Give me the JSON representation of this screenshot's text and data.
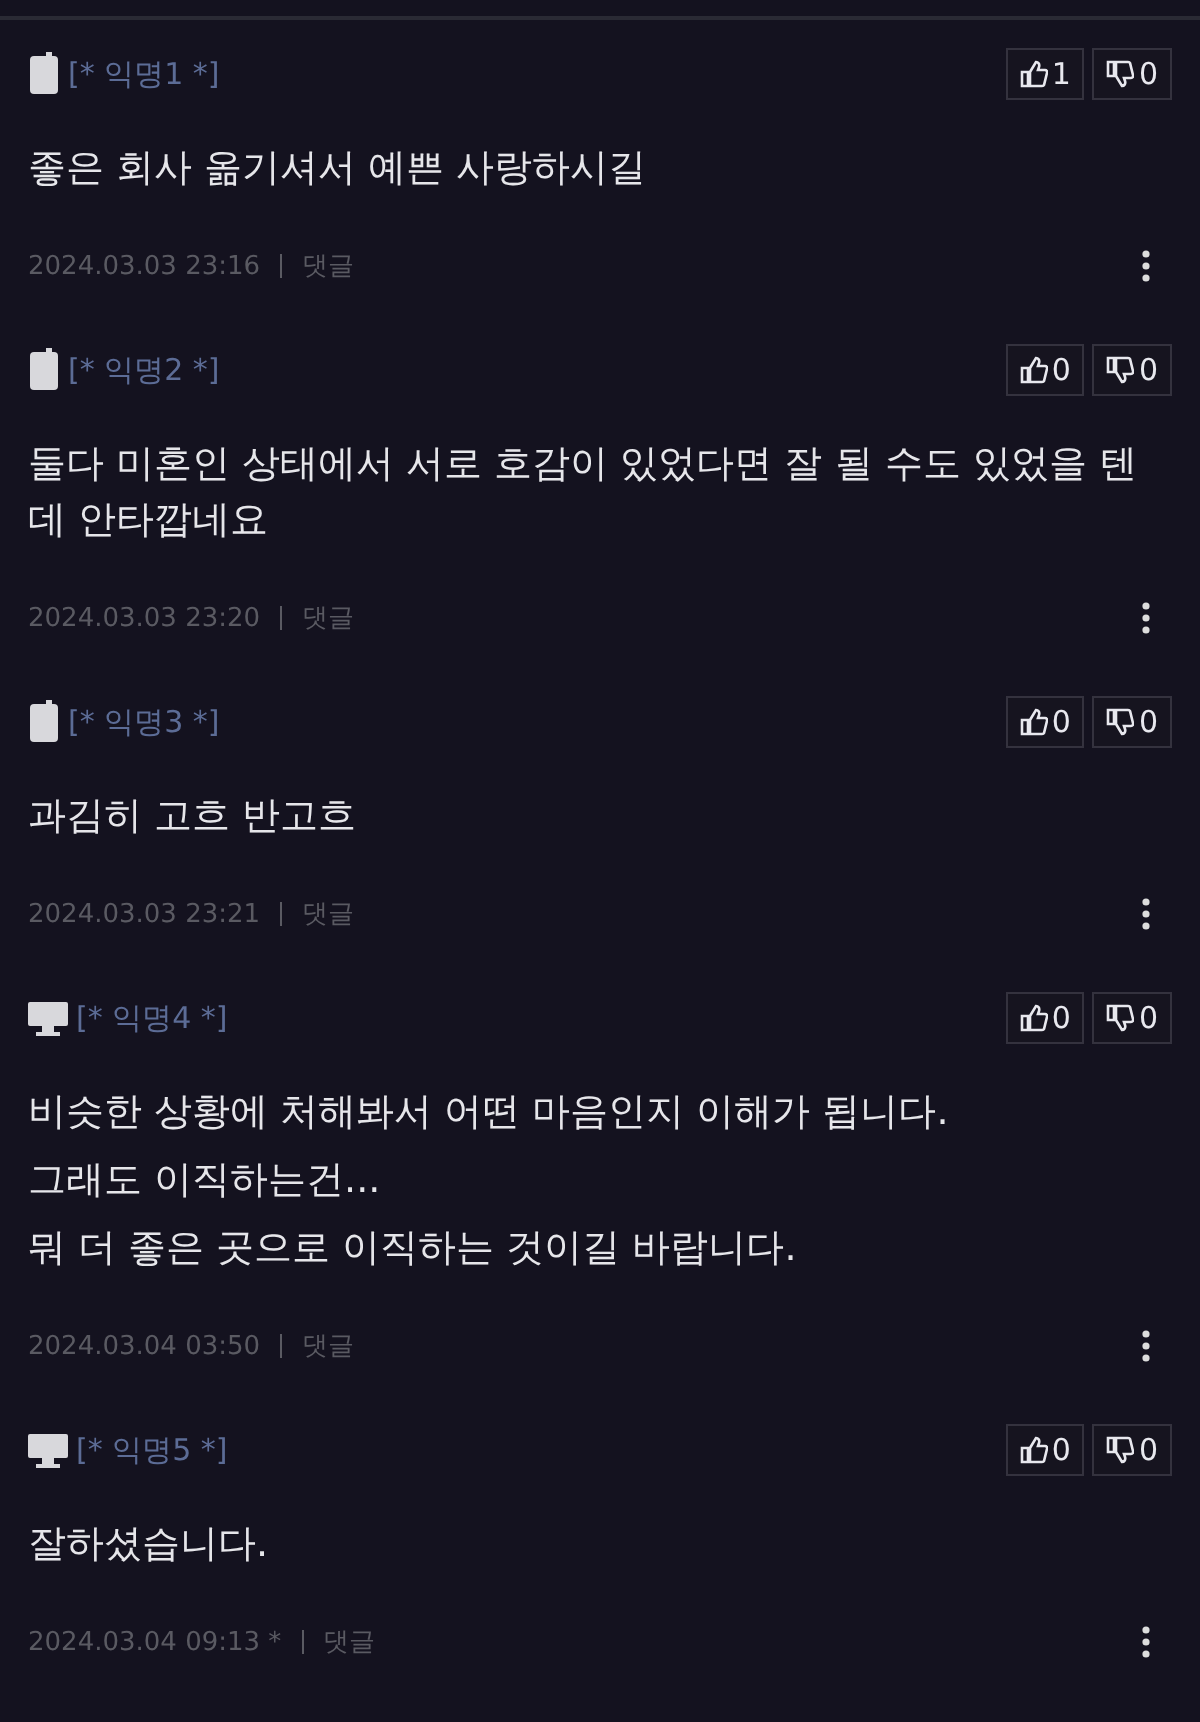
{
  "comments": [
    {
      "kind": "mobile",
      "author": "[* 익명1 *]",
      "likes": "1",
      "dislikes": "0",
      "body": [
        "좋은 회사 옮기셔서 예쁜 사랑하시길"
      ],
      "date": "2024.03.03 23:16",
      "reply": "댓글"
    },
    {
      "kind": "mobile",
      "author": "[* 익명2 *]",
      "likes": "0",
      "dislikes": "0",
      "body": [
        "둘다 미혼인 상태에서 서로 호감이 있었다면 잘 될 수도 있었을 텐데 안타깝네요"
      ],
      "date": "2024.03.03 23:20",
      "reply": "댓글"
    },
    {
      "kind": "mobile",
      "author": "[* 익명3 *]",
      "likes": "0",
      "dislikes": "0",
      "body": [
        "과김히 고흐 반고흐"
      ],
      "date": "2024.03.03 23:21",
      "reply": "댓글"
    },
    {
      "kind": "pc",
      "author": "[* 익명4 *]",
      "likes": "0",
      "dislikes": "0",
      "body": [
        "비슷한 상황에 처해봐서 어떤 마음인지 이해가 됩니다.",
        "그래도 이직하는건...",
        "뭐 더 좋은 곳으로 이직하는 것이길 바랍니다."
      ],
      "date": "2024.03.04 03:50",
      "reply": "댓글"
    },
    {
      "kind": "pc",
      "author": "[* 익명5 *]",
      "likes": "0",
      "dislikes": "0",
      "body": [
        "잘하셨습니다."
      ],
      "date": "2024.03.04 09:13 *",
      "reply": "댓글"
    }
  ]
}
